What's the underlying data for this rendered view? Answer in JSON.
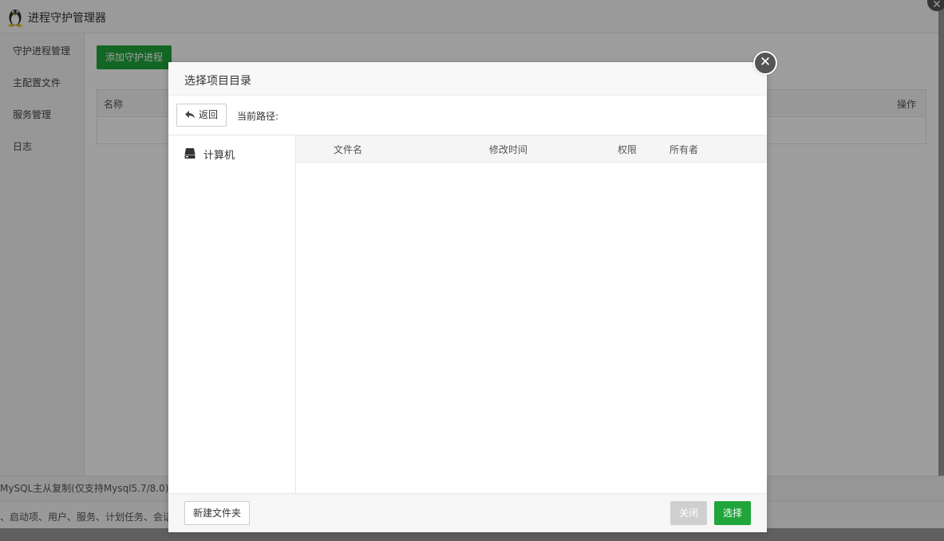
{
  "app": {
    "title": "进程守护管理器",
    "logo_icon": "tux-penguin-icon"
  },
  "sidebar": {
    "items": [
      {
        "label": "守护进程管理"
      },
      {
        "label": "主配置文件"
      },
      {
        "label": "服务管理"
      },
      {
        "label": "日志"
      }
    ]
  },
  "main": {
    "add_button_label": "添加守护进程",
    "table": {
      "columns": {
        "name": "名称",
        "operation": "操作"
      }
    }
  },
  "background_strips": {
    "line1": "MySQL主从复制(仅支持Mysql5.7/8.0)>",
    "line2": "、启动项、用户、服务、计划任务、会话"
  },
  "dialog": {
    "title": "选择项目目录",
    "close_icon": "close-icon",
    "toolbar": {
      "back_label": "返回",
      "back_icon": "back-arrow-icon",
      "current_path_label": "当前路径:"
    },
    "tree": {
      "computer_label": "计算机",
      "computer_icon": "hard-drive-icon"
    },
    "file_table": {
      "columns": {
        "name": "文件名",
        "mtime": "修改时间",
        "permission": "权限",
        "owner": "所有者"
      },
      "rows": []
    },
    "footer": {
      "new_folder_label": "新建文件夹",
      "close_label": "关闭",
      "select_label": "选择"
    }
  },
  "colors": {
    "accent_green": "#20a53a",
    "disabled_gray": "#cfcfcf",
    "close_circle": "#555555"
  }
}
